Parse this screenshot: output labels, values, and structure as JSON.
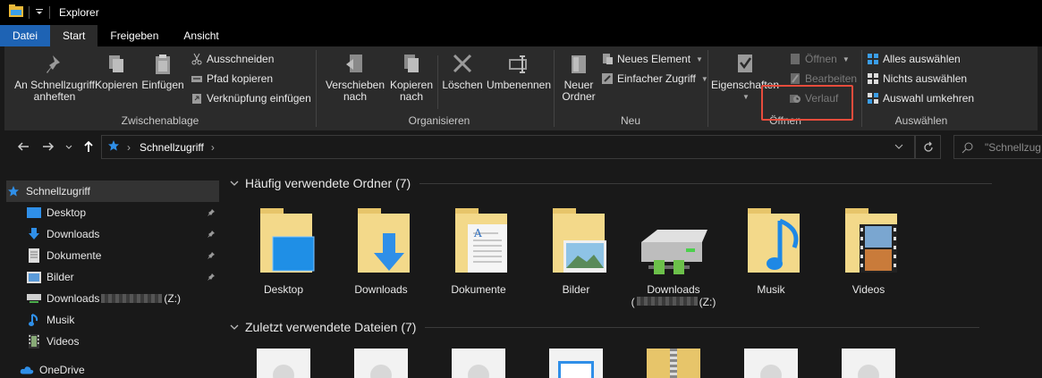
{
  "window": {
    "title": "Explorer"
  },
  "tabs": [
    {
      "label": "Datei"
    },
    {
      "label": "Start"
    },
    {
      "label": "Freigeben"
    },
    {
      "label": "Ansicht"
    }
  ],
  "ribbon": {
    "clipboard": {
      "label": "Zwischenablage",
      "pin": "An Schnellzugriff\nanheften",
      "copy": "Kopieren",
      "paste": "Einfügen",
      "cut": "Ausschneiden",
      "copy_path": "Pfad kopieren",
      "paste_shortcut": "Verknüpfung einfügen"
    },
    "organize": {
      "label": "Organisieren",
      "move": "Verschieben\nnach",
      "copy_to": "Kopieren\nnach",
      "delete": "Löschen",
      "rename": "Umbenennen"
    },
    "new": {
      "label": "Neu",
      "new_folder": "Neuer\nOrdner",
      "new_item": "Neues Element",
      "easy_access": "Einfacher Zugriff"
    },
    "open": {
      "label": "Öffnen",
      "properties": "Eigenschaften",
      "open": "Öffnen",
      "edit": "Bearbeiten",
      "history": "Verlauf"
    },
    "select": {
      "label": "Auswählen",
      "select_all": "Alles auswählen",
      "select_none": "Nichts auswählen",
      "invert": "Auswahl umkehren"
    }
  },
  "address": {
    "crumb": "Schnellzugriff",
    "search_placeholder": "\"Schnellzug"
  },
  "sidebar": {
    "items": [
      {
        "label": "Schnellzugriff"
      },
      {
        "label": "Desktop"
      },
      {
        "label": "Downloads"
      },
      {
        "label": "Dokumente"
      },
      {
        "label": "Bilder"
      },
      {
        "label": "Downloads",
        "suffix": "(Z:)"
      },
      {
        "label": "Musik"
      },
      {
        "label": "Videos"
      },
      {
        "label": "OneDrive"
      }
    ]
  },
  "content": {
    "frequent": {
      "title": "Häufig verwendete Ordner (7)",
      "folders": [
        {
          "label": "Desktop"
        },
        {
          "label": "Downloads"
        },
        {
          "label": "Dokumente"
        },
        {
          "label": "Bilder"
        },
        {
          "label": "Downloads",
          "suffix": "(Z:)"
        },
        {
          "label": "Musik"
        },
        {
          "label": "Videos"
        }
      ]
    },
    "recent": {
      "title": "Zuletzt verwendete Dateien (7)"
    }
  }
}
